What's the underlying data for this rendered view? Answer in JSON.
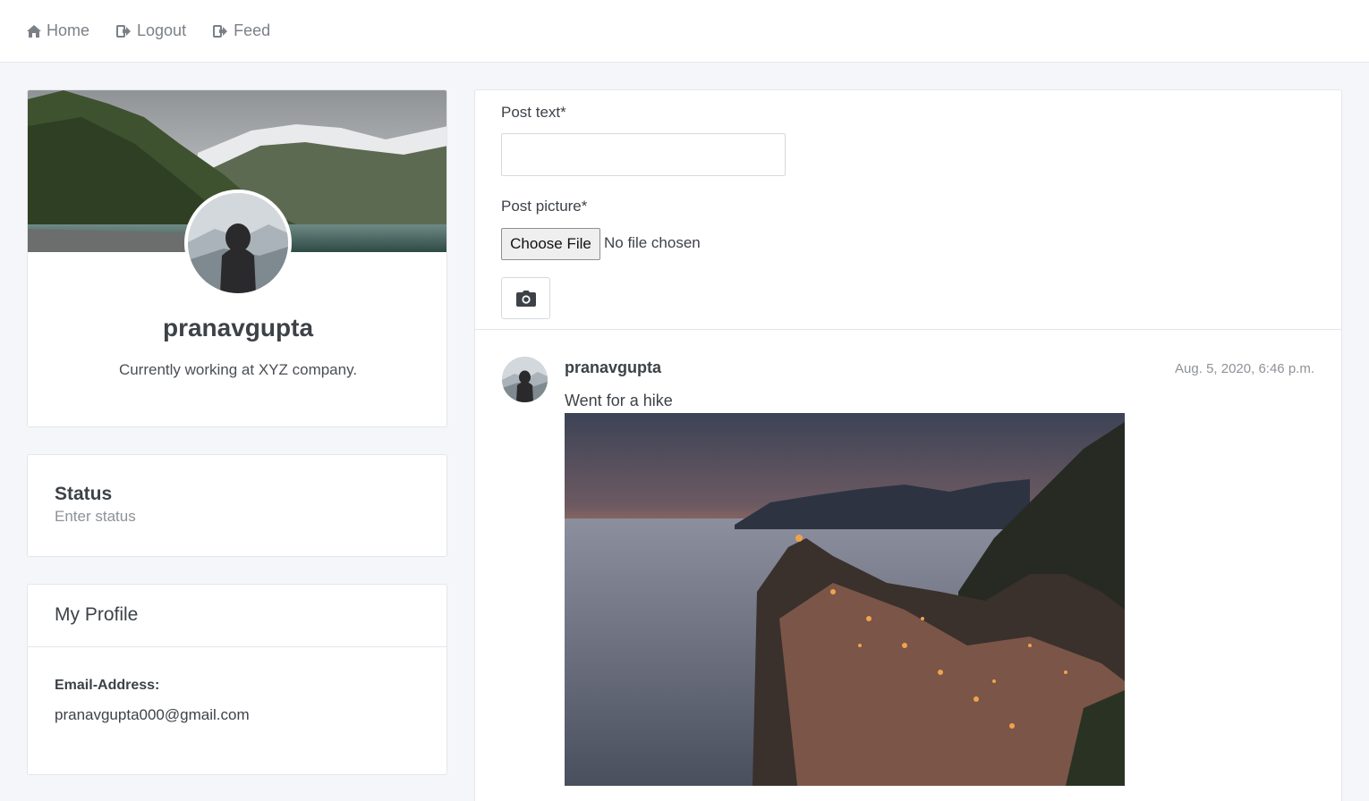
{
  "nav": {
    "items": [
      {
        "label": "Home",
        "icon": "home-icon"
      },
      {
        "label": "Logout",
        "icon": "logout-icon"
      },
      {
        "label": "Feed",
        "icon": "feed-icon"
      }
    ]
  },
  "profile": {
    "username": "pranavgupta",
    "bio": "Currently working at XYZ company."
  },
  "status": {
    "title": "Status",
    "placeholder": "Enter status"
  },
  "my_profile": {
    "title": "My Profile",
    "email_label": "Email-Address:",
    "email_value": "pranavgupta000@gmail.com"
  },
  "post_form": {
    "text_label": "Post text*",
    "picture_label": "Post picture*",
    "choose_file_label": "Choose File",
    "no_file_text": "No file chosen"
  },
  "post": {
    "author": "pranavgupta",
    "timestamp": "Aug. 5, 2020, 6:46 p.m.",
    "text": "Went for a hike"
  },
  "colors": {
    "background": "#f5f6fa",
    "card": "#ffffff",
    "nav_text": "#7b8087",
    "text": "#3d4248",
    "muted": "#8d9298"
  }
}
